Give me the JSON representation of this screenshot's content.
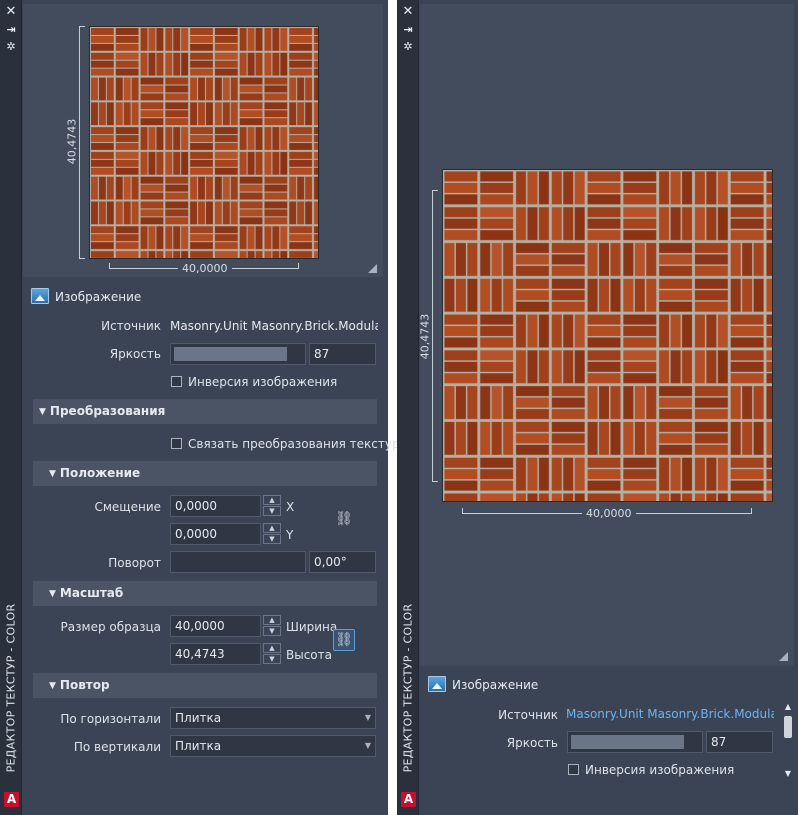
{
  "palette_title": "РЕДАКТОР ТЕКСТУР - COLOR",
  "icons": {
    "close": "✕",
    "pin": "⇥",
    "gear": "✲",
    "logo": "A",
    "link": "⛓",
    "spin_up": "▲",
    "spin_down": "▼",
    "section_open": "▼",
    "dropdown": "▼",
    "scroll_up": "▲",
    "scroll_down": "▼"
  },
  "preview": {
    "width_label": "40,0000",
    "height_label": "40,4743"
  },
  "image_section": {
    "label": "Изображение",
    "source_label": "Источник",
    "source_value": "Masonry.Unit Masonry.Brick.Modular.B",
    "source_value_right": "Masonry.Unit Masonry.Brick.Modular.Ba",
    "brightness_label": "Яркость",
    "brightness_value": "87",
    "brightness_fraction": 0.87,
    "invert_label": "Инверсия изображения"
  },
  "transforms": {
    "label": "Преобразования",
    "link_label": "Связать преобразования текстур"
  },
  "position": {
    "label": "Положение",
    "offset_label": "Смещение",
    "offset_x": "0,0000",
    "offset_y": "0,0000",
    "x_axis": "X",
    "y_axis": "Y",
    "rotation_label": "Поворот",
    "rotation_value": "0,00°"
  },
  "scale": {
    "label": "Масштаб",
    "sample_size_label": "Размер образца",
    "width_value": "40,0000",
    "height_value": "40,4743",
    "width_label": "Ширина",
    "height_label": "Высота"
  },
  "repeat": {
    "label": "Повтор",
    "horizontal_label": "По горизонтали",
    "horizontal_value": "Плитка",
    "vertical_label": "По вертикали",
    "vertical_value": "Плитка"
  },
  "colors": {
    "palette_bg": "#3b4454",
    "section_bg": "#4a5465",
    "link_accent": "#6fb3ee",
    "logo_red": "#c8102e"
  }
}
